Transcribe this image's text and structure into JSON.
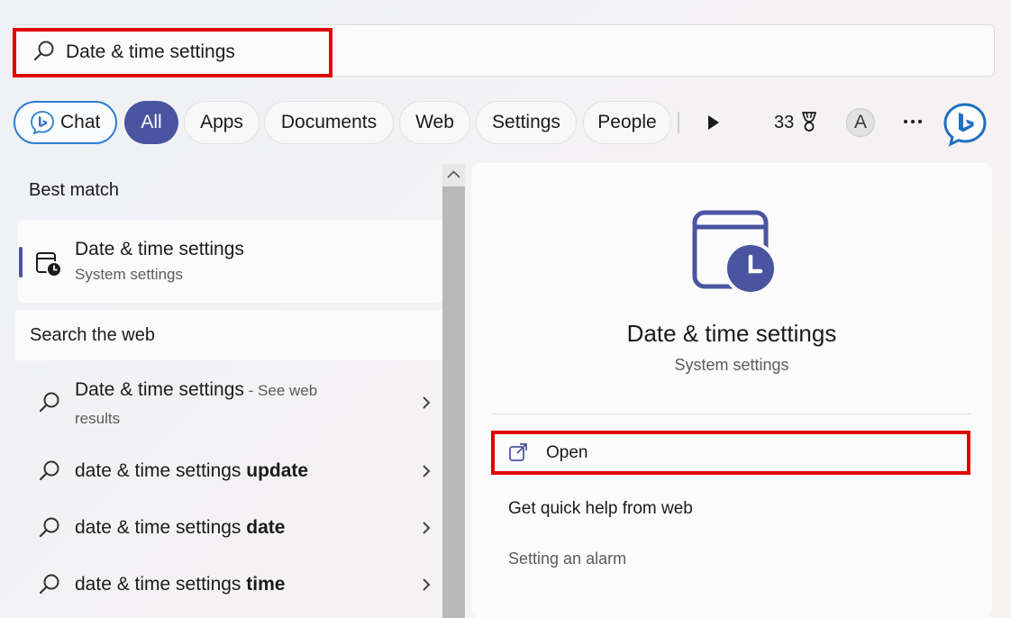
{
  "search": {
    "query": "Date & time settings"
  },
  "filters": {
    "chat": "Chat",
    "all": "All",
    "apps": "Apps",
    "documents": "Documents",
    "web": "Web",
    "settings": "Settings",
    "people": "People"
  },
  "toolbar": {
    "points": "33",
    "avatar_initial": "A"
  },
  "left": {
    "best_match_label": "Best match",
    "best_match": {
      "title": "Date & time settings",
      "subtitle": "System settings"
    },
    "web_header": "Search the web",
    "web_results": [
      {
        "text": "Date & time settings",
        "suffix": " - See web",
        "line2": "results"
      },
      {
        "text": "date & time settings ",
        "bold": "update"
      },
      {
        "text": "date & time settings ",
        "bold": "date"
      },
      {
        "text": "date & time settings ",
        "bold": "time"
      }
    ]
  },
  "right": {
    "title": "Date & time settings",
    "subtitle": "System settings",
    "open": "Open",
    "quick_help": "Get quick help from web",
    "setting_alarm": "Setting an alarm"
  },
  "colors": {
    "accent": "#4a55a1",
    "highlight": "#e00000",
    "chat_border": "#2d7fd0"
  }
}
